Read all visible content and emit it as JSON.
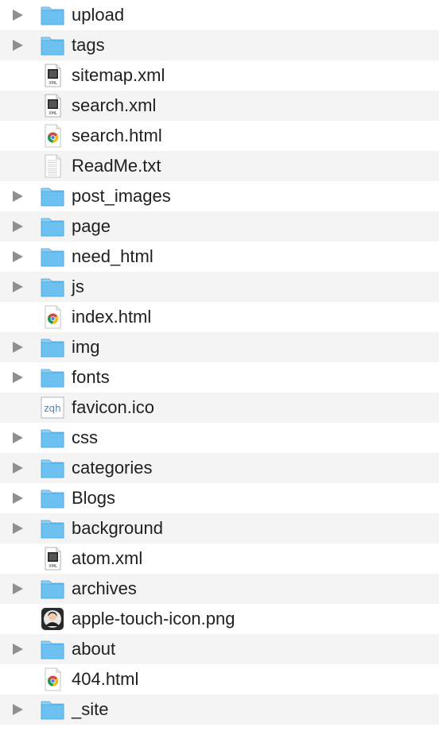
{
  "finder": {
    "items": [
      {
        "name": "upload",
        "kind": "folder",
        "icon": "folder-icon",
        "expandable": true
      },
      {
        "name": "tags",
        "kind": "folder",
        "icon": "folder-icon",
        "expandable": true
      },
      {
        "name": "sitemap.xml",
        "kind": "xml",
        "icon": "xml-file-icon",
        "expandable": false
      },
      {
        "name": "search.xml",
        "kind": "xml",
        "icon": "xml-file-icon",
        "expandable": false
      },
      {
        "name": "search.html",
        "kind": "html",
        "icon": "chrome-html-file-icon",
        "expandable": false
      },
      {
        "name": "ReadMe.txt",
        "kind": "txt",
        "icon": "text-file-icon",
        "expandable": false
      },
      {
        "name": "post_images",
        "kind": "folder",
        "icon": "folder-icon",
        "expandable": true
      },
      {
        "name": "page",
        "kind": "folder",
        "icon": "folder-icon",
        "expandable": true
      },
      {
        "name": "need_html",
        "kind": "folder",
        "icon": "folder-icon",
        "expandable": true
      },
      {
        "name": "js",
        "kind": "folder",
        "icon": "folder-icon",
        "expandable": true
      },
      {
        "name": "index.html",
        "kind": "html",
        "icon": "chrome-html-file-icon",
        "expandable": false
      },
      {
        "name": "img",
        "kind": "folder",
        "icon": "folder-icon",
        "expandable": true
      },
      {
        "name": "fonts",
        "kind": "folder",
        "icon": "folder-icon",
        "expandable": true
      },
      {
        "name": "favicon.ico",
        "kind": "ico",
        "icon": "favicon-file-icon",
        "expandable": false,
        "thumb_text": "zqh"
      },
      {
        "name": "css",
        "kind": "folder",
        "icon": "folder-icon",
        "expandable": true
      },
      {
        "name": "categories",
        "kind": "folder",
        "icon": "folder-icon",
        "expandable": true
      },
      {
        "name": "Blogs",
        "kind": "folder",
        "icon": "folder-icon",
        "expandable": true
      },
      {
        "name": "background",
        "kind": "folder",
        "icon": "folder-icon",
        "expandable": true
      },
      {
        "name": "atom.xml",
        "kind": "xml",
        "icon": "xml-file-icon",
        "expandable": false
      },
      {
        "name": "archives",
        "kind": "folder",
        "icon": "folder-icon",
        "expandable": true
      },
      {
        "name": "apple-touch-icon.png",
        "kind": "png",
        "icon": "image-file-icon",
        "expandable": false
      },
      {
        "name": "about",
        "kind": "folder",
        "icon": "folder-icon",
        "expandable": true
      },
      {
        "name": "404.html",
        "kind": "html",
        "icon": "chrome-html-file-icon",
        "expandable": false
      },
      {
        "name": "_site",
        "kind": "folder",
        "icon": "folder-icon",
        "expandable": true
      }
    ],
    "colors": {
      "folder_body": "#6cc1f1",
      "folder_tab": "#8fd0f5",
      "folder_edge": "#4aa3dd",
      "row_alt": "#f4f4f4",
      "disclosure": "#8f8f8f"
    }
  }
}
